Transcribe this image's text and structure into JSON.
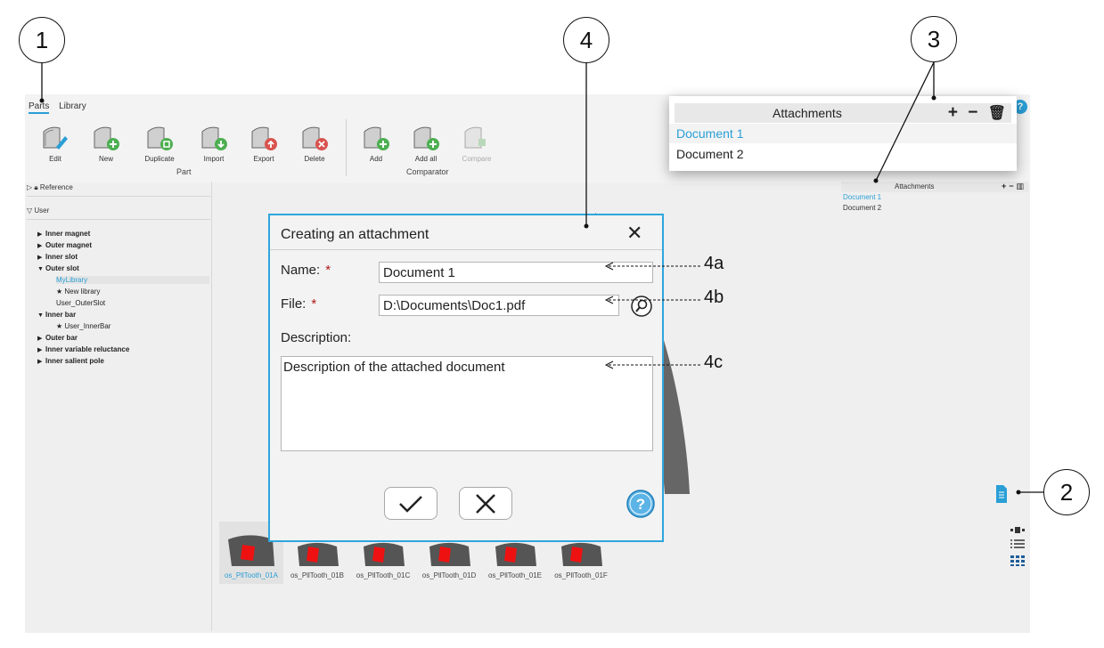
{
  "tabs": [
    "Parts",
    "Library"
  ],
  "toolbar": {
    "part_tools": [
      "Edit",
      "New",
      "Duplicate",
      "Import",
      "Export",
      "Delete"
    ],
    "comparator_tools": [
      "Add",
      "Add all",
      "Compare"
    ],
    "part_group": "Part",
    "comparator_group": "Comparator"
  },
  "tree": {
    "reference": "Reference",
    "user": "User",
    "nodes": [
      "Inner magnet",
      "Outer magnet",
      "Inner slot",
      "Outer slot",
      "MyLibrary",
      "New library",
      "User_OuterSlot",
      "Inner bar",
      "User_InnerBar",
      "Outer bar",
      "Inner variable reluctance",
      "Inner salient pole"
    ]
  },
  "thumbnails": [
    "os_PllTooth_01A",
    "os_PllTooth_01B",
    "os_PllTooth_01C",
    "os_PllTooth_01D",
    "os_PllTooth_01E",
    "os_PllTooth_01F"
  ],
  "attachments_panel": {
    "title": "Attachments",
    "items": [
      "Document 1",
      "Document 2"
    ],
    "plus": "+",
    "minus": "−"
  },
  "dialog": {
    "title": "Creating an attachment",
    "close": "✕",
    "name_label": "Name:",
    "name_value": "Document 1",
    "file_label": "File:",
    "file_value": "D:\\Documents\\Doc1.pdf",
    "description_label": "Description:",
    "description_value": "Description of the attached document",
    "required_mark": "*",
    "help": "?"
  },
  "callouts": [
    "1",
    "2",
    "3",
    "4"
  ],
  "annotations": [
    "4a",
    "4b",
    "4c"
  ],
  "colors": {
    "accent": "#2a9fd6",
    "dialog_border": "#2ea6dd",
    "required": "#b01818"
  }
}
